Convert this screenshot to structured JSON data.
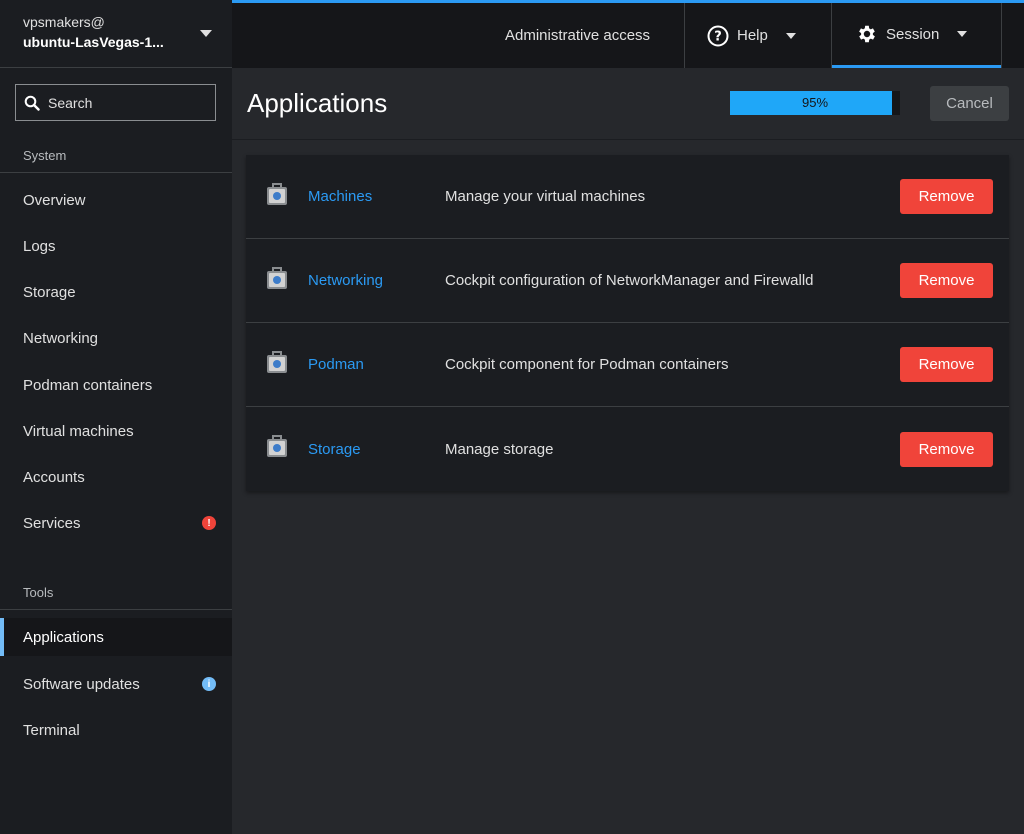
{
  "host": {
    "user": "vpsmakers@",
    "name": "ubuntu-LasVegas-1..."
  },
  "search": {
    "placeholder": "Search"
  },
  "sidebar": {
    "system_label": "System",
    "tools_label": "Tools",
    "system_items": [
      {
        "label": "Overview"
      },
      {
        "label": "Logs"
      },
      {
        "label": "Storage"
      },
      {
        "label": "Networking"
      },
      {
        "label": "Podman containers"
      },
      {
        "label": "Virtual machines"
      },
      {
        "label": "Accounts"
      },
      {
        "label": "Services",
        "badge": "!"
      }
    ],
    "tools_items": [
      {
        "label": "Applications",
        "active": true
      },
      {
        "label": "Software updates",
        "badge": "i"
      },
      {
        "label": "Terminal"
      }
    ]
  },
  "masthead": {
    "admin_label": "Administrative access",
    "help_label": "Help",
    "session_label": "Session"
  },
  "page": {
    "title": "Applications",
    "progress_text": "95%",
    "progress_value": 0.95,
    "cancel_label": "Cancel"
  },
  "apps": [
    {
      "name": "Machines",
      "description": "Manage your virtual machines",
      "action": "Remove"
    },
    {
      "name": "Networking",
      "description": "Cockpit configuration of NetworkManager and Firewalld",
      "action": "Remove"
    },
    {
      "name": "Podman",
      "description": "Cockpit component for Podman containers",
      "action": "Remove"
    },
    {
      "name": "Storage",
      "description": "Manage storage",
      "action": "Remove"
    }
  ],
  "colors": {
    "accent": "#2b9af3",
    "danger": "#f0443a",
    "info": "#73bcf7",
    "sidebar_bg": "#1b1d21",
    "page_bg": "#26282c"
  }
}
